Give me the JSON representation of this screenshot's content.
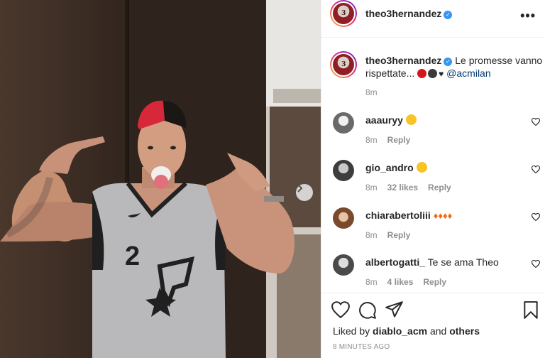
{
  "post": {
    "username": "theo3hernandez",
    "avatar_text": "3",
    "more_icon": "more-horizontal-icon"
  },
  "caption": {
    "username": "theo3hernandez",
    "text": "Le promesse vanno rispettate...",
    "emoji_colors": [
      "#d9131c",
      "#3a3a3a"
    ],
    "heart": "♥",
    "mention": "@acmilan",
    "time": "8m"
  },
  "comments": [
    {
      "username": "aaauryy",
      "text": "",
      "emojis": [
        "heart-eyes"
      ],
      "time": "8m",
      "likes": "",
      "reply": "Reply"
    },
    {
      "username": "gio_andro",
      "text": "",
      "emojis": [
        "heart-eyes"
      ],
      "time": "8m",
      "likes": "32 likes",
      "reply": "Reply"
    },
    {
      "username": "chiarabertoliii",
      "text": "",
      "emojis": [
        "fire",
        "fire",
        "fire",
        "fire"
      ],
      "time": "8m",
      "likes": "",
      "reply": "Reply"
    },
    {
      "username": "albertogatti_",
      "text": "Te se ama Theo",
      "emojis": [],
      "time": "8m",
      "likes": "4 likes",
      "reply": "Reply"
    }
  ],
  "actions": {
    "liked_prefix": "Liked by",
    "liked_user": "diablo_acm",
    "liked_and": "and",
    "liked_others": "others",
    "timestamp": "8 MINUTES AGO"
  },
  "photo": {
    "jersey_number": "2",
    "jersey_logo": "Spurs",
    "next_icon": "chevron-right-icon"
  },
  "colors": {
    "link": "#00376b",
    "muted": "#8e8e8e",
    "verified": "#3897f0",
    "border": "#efefef"
  }
}
